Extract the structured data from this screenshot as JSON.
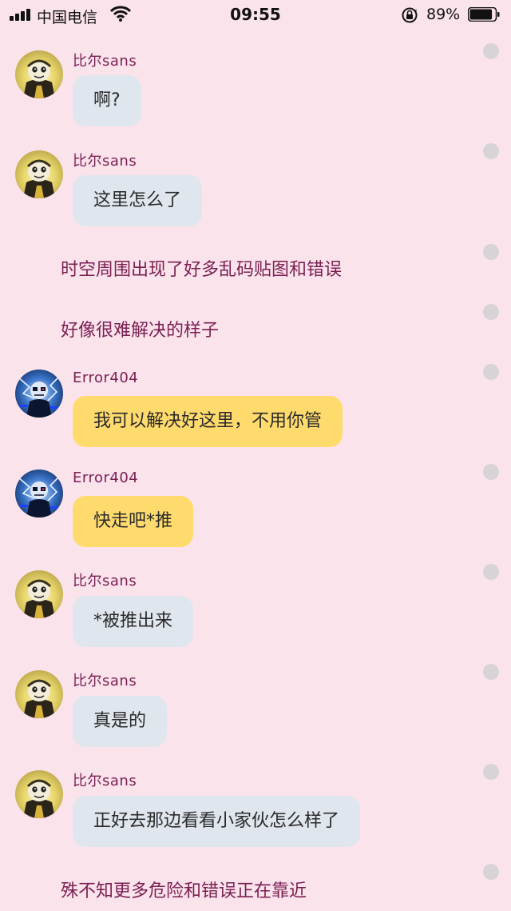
{
  "status_bar": {
    "carrier": "中国电信",
    "time": "09:55",
    "battery_percent": "89%",
    "battery_level": 0.89
  },
  "messages": [
    {
      "type": "chat",
      "sender": "比尔sans",
      "text": "啊?",
      "bubble_color": "#e0e6ee",
      "avatar": "bill-sans-avatar"
    },
    {
      "type": "chat",
      "sender": "比尔sans",
      "text": "这里怎么了",
      "bubble_color": "#e0e6ee",
      "avatar": "bill-sans-avatar"
    },
    {
      "type": "narration",
      "text": "时空周围出现了好多乱码贴图和错误"
    },
    {
      "type": "narration",
      "text": "好像很难解决的样子"
    },
    {
      "type": "chat",
      "sender": "Error404",
      "text": "我可以解决好这里，不用你管",
      "bubble_color": "#ffdb6e",
      "avatar": "error404-avatar"
    },
    {
      "type": "chat",
      "sender": "Error404",
      "text": "快走吧*推",
      "bubble_color": "#ffdb6e",
      "avatar": "error404-avatar"
    },
    {
      "type": "chat",
      "sender": "比尔sans",
      "text": "*被推出来",
      "bubble_color": "#e0e6ee",
      "avatar": "bill-sans-avatar"
    },
    {
      "type": "chat",
      "sender": "比尔sans",
      "text": "真是的",
      "bubble_color": "#e0e6ee",
      "avatar": "bill-sans-avatar"
    },
    {
      "type": "chat",
      "sender": "比尔sans",
      "text": "正好去那边看看小家伙怎么样了",
      "bubble_color": "#e0e6ee",
      "avatar": "bill-sans-avatar"
    },
    {
      "type": "narration",
      "text": "殊不知更多危险和错误正在靠近"
    }
  ]
}
